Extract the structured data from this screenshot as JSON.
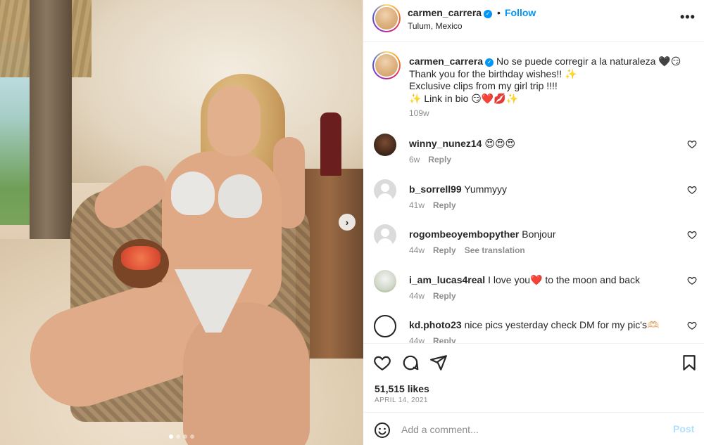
{
  "post": {
    "username": "carmen_carrera",
    "follow_label": "Follow",
    "dot": "•",
    "location": "Tulum, Mexico",
    "more_label": "•••"
  },
  "caption": {
    "username": "carmen_carrera",
    "line1": "No se puede corregir a la naturaleza 🖤😏",
    "line2": "Thank you for the birthday wishes!! ✨",
    "line3": "Exclusive clips from my girl trip !!!!",
    "line4": "✨ Link in bio 😏❤️💋✨",
    "time": "109w"
  },
  "comments": [
    {
      "username": "winny_nunez14",
      "text": "😍😍😍",
      "time": "6w",
      "reply": "Reply",
      "extra": ""
    },
    {
      "username": "b_sorrell99",
      "text": "Yummyyy",
      "time": "41w",
      "reply": "Reply",
      "extra": ""
    },
    {
      "username": "rogombeoyembopyther",
      "text": "Bonjour",
      "time": "44w",
      "reply": "Reply",
      "extra": "See translation"
    },
    {
      "username": "i_am_lucas4real",
      "text": "I love you❤️ to the moon and back",
      "time": "44w",
      "reply": "Reply",
      "extra": ""
    },
    {
      "username": "kd.photo23",
      "text": "nice pics yesterday check DM for my pic's🫶🏻",
      "time": "44w",
      "reply": "Reply",
      "extra": ""
    }
  ],
  "stats": {
    "likes": "51,515 likes",
    "date": "APRIL 14, 2021"
  },
  "composer": {
    "placeholder": "Add a comment...",
    "post_label": "Post"
  },
  "colors": {
    "accent": "#0095f6",
    "muted": "#8e8e8e",
    "post_disabled": "#b2dffc"
  },
  "icons": {
    "header": [
      "verified-badge-icon",
      "more-icon"
    ],
    "actions": [
      "heart-icon",
      "comment-icon",
      "share-icon",
      "bookmark-icon"
    ],
    "composer": [
      "emoji-icon"
    ],
    "carousel": [
      "chevron-right-icon"
    ]
  },
  "carousel": {
    "current": 1,
    "total": 4
  }
}
